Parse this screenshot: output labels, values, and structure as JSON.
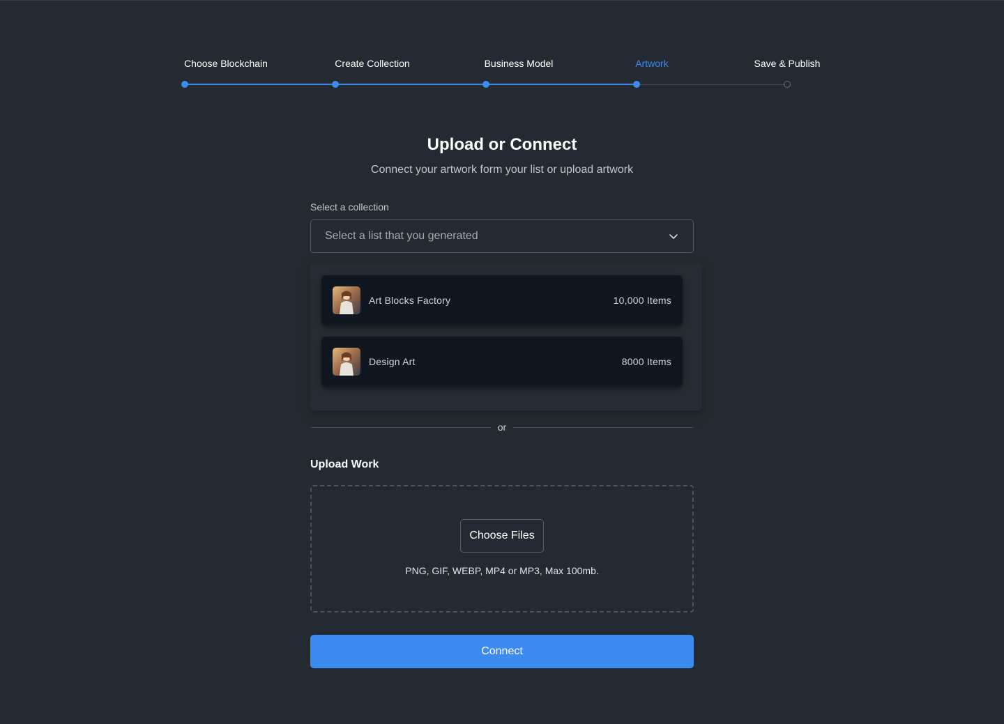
{
  "stepper": {
    "steps": [
      {
        "label": "Choose Blockchain",
        "state": "done"
      },
      {
        "label": "Create Collection",
        "state": "done"
      },
      {
        "label": "Business Model",
        "state": "done"
      },
      {
        "label": "Artwork",
        "state": "active"
      },
      {
        "label": "Save & Publish",
        "state": "todo"
      }
    ]
  },
  "header": {
    "title": "Upload or Connect",
    "subtitle": "Connect your artwork form your list or upload artwork"
  },
  "collection_select": {
    "label": "Select a collection",
    "placeholder": "Select a list that you generated",
    "icon": "chevron-down-icon",
    "options": [
      {
        "name": "Art Blocks Factory",
        "count": "10,000 Items"
      },
      {
        "name": "Design Art",
        "count": "8000 Items"
      }
    ]
  },
  "divider": {
    "text": "or"
  },
  "upload": {
    "title": "Upload Work",
    "button_label": "Choose Files",
    "hint": "PNG, GIF, WEBP, MP4 or MP3, Max 100mb."
  },
  "actions": {
    "connect_label": "Connect"
  },
  "colors": {
    "background": "#242a31",
    "accent": "#3d8bf0",
    "card": "#111720"
  }
}
